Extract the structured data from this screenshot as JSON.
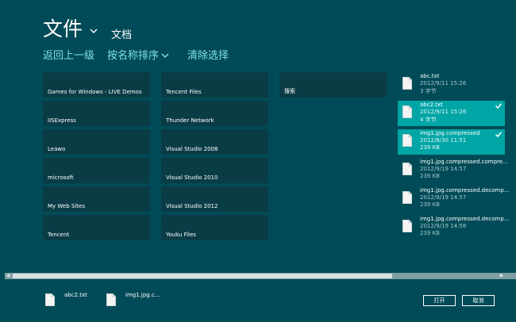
{
  "header": {
    "title": "文件",
    "location": "文档"
  },
  "commands": {
    "up_label": "返回上一级",
    "sort_label": "按名称排序",
    "clear_label": "清除选择"
  },
  "folders": [
    {
      "name": "Games for Windows - LIVE Demos"
    },
    {
      "name": "IISExpress"
    },
    {
      "name": "Leawo"
    },
    {
      "name": "microsoft"
    },
    {
      "name": "My Web Sites"
    },
    {
      "name": "Tencent"
    },
    {
      "name": "Tencent Files"
    },
    {
      "name": "Thunder Network"
    },
    {
      "name": "Visual Studio 2008"
    },
    {
      "name": "Visual Studio 2010"
    },
    {
      "name": "Visual Studio 2012"
    },
    {
      "name": "Youku Files"
    },
    {
      "name": "搜索"
    }
  ],
  "files": [
    {
      "name": "abc.txt",
      "date": "2012/9/11 15:26",
      "size": "3 字节",
      "selected": false
    },
    {
      "name": "abc2.txt",
      "date": "2012/9/11 15:26",
      "size": "4 字节",
      "selected": true
    },
    {
      "name": "img1.jpg.compressed",
      "date": "2012/8/30 11:51",
      "size": "239 KB",
      "selected": true
    },
    {
      "name": "img1.jpg.compressed.compre...",
      "date": "2012/9/19 14:57",
      "size": "239 KB",
      "selected": false
    },
    {
      "name": "img1.jpg.compressed.decomp...",
      "date": "2012/9/19 14:57",
      "size": "239 KB",
      "selected": false
    },
    {
      "name": "img1.jpg.compressed.decomp...",
      "date": "2012/9/19 14:58",
      "size": "239 KB",
      "selected": false
    }
  ],
  "basket": [
    {
      "name": "abc2.txt"
    },
    {
      "name": "img1.jpg.c..."
    }
  ],
  "buttons": {
    "open_label": "打开",
    "cancel_label": "取消"
  },
  "colors": {
    "background": "#004b57",
    "tile": "#0a3c46",
    "selected": "#00a5a5",
    "accent_text": "#7ee0e8"
  }
}
